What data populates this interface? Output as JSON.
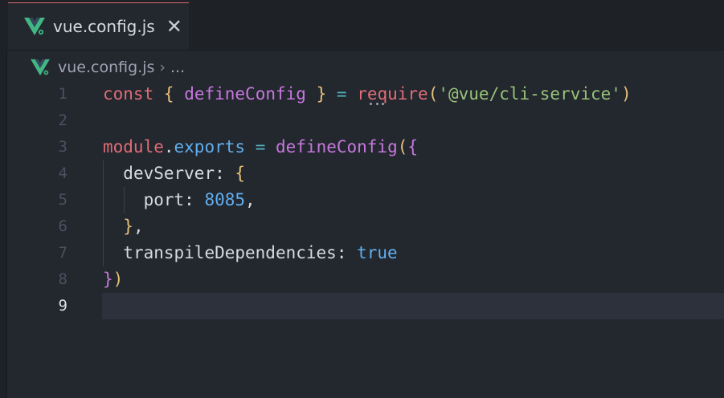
{
  "tab": {
    "title": "vue.config.js",
    "close_glyph": "✕",
    "icon": "vue-icon"
  },
  "breadcrumb": {
    "file": "vue.config.js",
    "separator": "›",
    "more": "..."
  },
  "colors": {
    "vue_green": "#41b883",
    "vue_dark": "#35495e",
    "tab_accent": "#e06c75"
  },
  "code": {
    "line_numbers": [
      "1",
      "2",
      "3",
      "4",
      "5",
      "6",
      "7",
      "8",
      "9"
    ],
    "active_line": "9",
    "lines": [
      [
        {
          "t": "const",
          "c": "kw"
        },
        {
          "t": " ",
          "c": "pl"
        },
        {
          "t": "{",
          "c": "b1"
        },
        {
          "t": " ",
          "c": "pl"
        },
        {
          "t": "defineConfig",
          "c": "vr"
        },
        {
          "t": " ",
          "c": "pl"
        },
        {
          "t": "}",
          "c": "b1"
        },
        {
          "t": " ",
          "c": "pl"
        },
        {
          "t": "=",
          "c": "op"
        },
        {
          "t": " ",
          "c": "pl"
        },
        {
          "t": "require",
          "c": "kw"
        },
        {
          "t": "(",
          "c": "b1"
        },
        {
          "t": "'@vue/cli-service'",
          "c": "st"
        },
        {
          "t": ")",
          "c": "b1"
        }
      ],
      [],
      [
        {
          "t": "module",
          "c": "kw"
        },
        {
          "t": ".",
          "c": "pl"
        },
        {
          "t": "exports",
          "c": "nu"
        },
        {
          "t": " ",
          "c": "pl"
        },
        {
          "t": "=",
          "c": "op"
        },
        {
          "t": " ",
          "c": "pl"
        },
        {
          "t": "defineConfig",
          "c": "fn"
        },
        {
          "t": "(",
          "c": "b1"
        },
        {
          "t": "{",
          "c": "b2"
        }
      ],
      [
        {
          "t": "  ",
          "c": "pl"
        },
        {
          "t": "devServer",
          "c": "pr"
        },
        {
          "t": ": ",
          "c": "pl"
        },
        {
          "t": "{",
          "c": "b3"
        }
      ],
      [
        {
          "t": "    ",
          "c": "pl"
        },
        {
          "t": "port",
          "c": "pr"
        },
        {
          "t": ": ",
          "c": "pl"
        },
        {
          "t": "8085",
          "c": "nu"
        },
        {
          "t": ",",
          "c": "pl"
        }
      ],
      [
        {
          "t": "  ",
          "c": "pl"
        },
        {
          "t": "}",
          "c": "b3"
        },
        {
          "t": ",",
          "c": "pl"
        }
      ],
      [
        {
          "t": "  ",
          "c": "pl"
        },
        {
          "t": "transpileDependencies",
          "c": "pr"
        },
        {
          "t": ": ",
          "c": "pl"
        },
        {
          "t": "true",
          "c": "bl"
        }
      ],
      [
        {
          "t": "}",
          "c": "b2"
        },
        {
          "t": ")",
          "c": "b1"
        }
      ],
      []
    ]
  }
}
